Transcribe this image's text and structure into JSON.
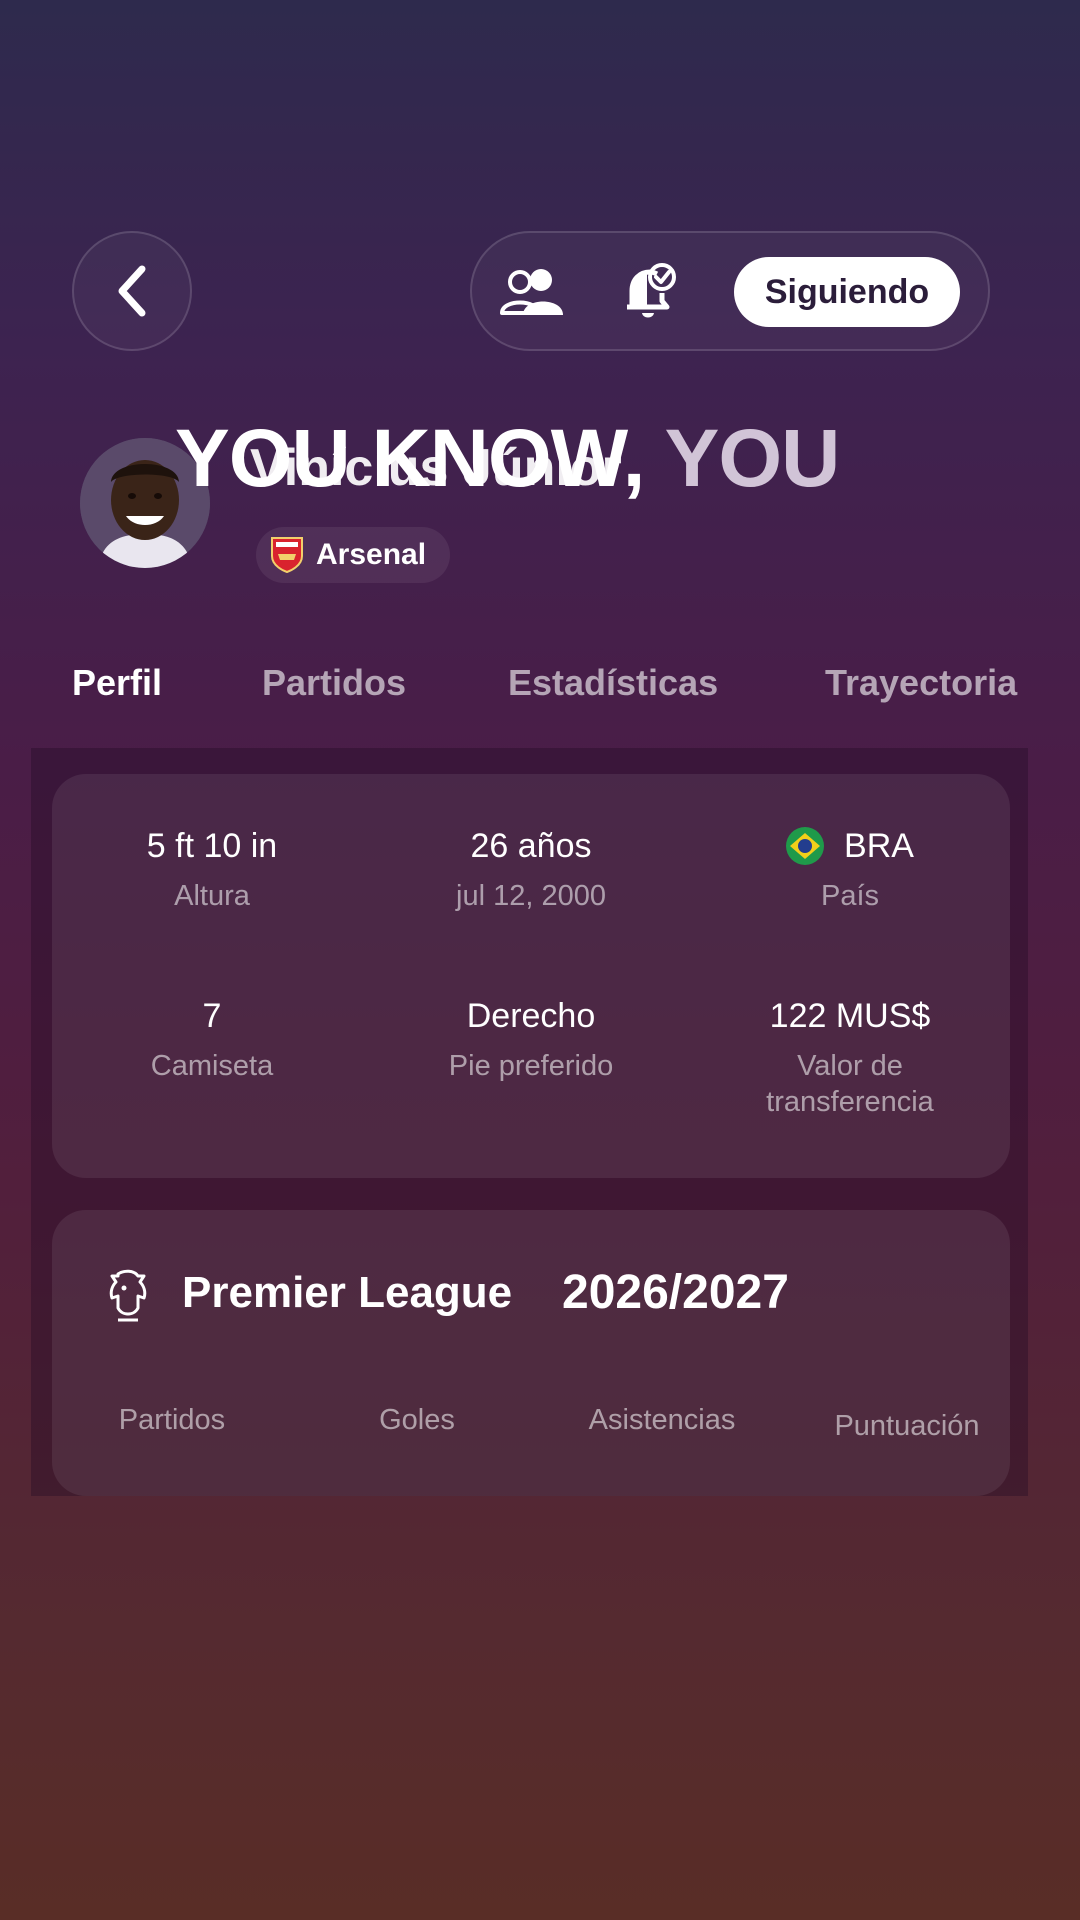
{
  "header": {
    "back_icon": "chevron-left-icon",
    "compare_icon": "users-icon",
    "notify_icon": "bell-check-icon",
    "follow_label": "Siguiendo"
  },
  "player": {
    "name": "Vinícius Júnior",
    "overlay_text_a": "YOU KNOW,",
    "overlay_text_b": "YOU",
    "team": "Arsenal"
  },
  "tabs": [
    {
      "label": "Perfil",
      "active": true
    },
    {
      "label": "Partidos",
      "active": false
    },
    {
      "label": "Estadísticas",
      "active": false
    },
    {
      "label": "Trayectoria",
      "active": false
    }
  ],
  "profile": {
    "height": {
      "value": "5 ft 10 in",
      "label": "Altura"
    },
    "age": {
      "value": "26 años",
      "label": "jul 12, 2000"
    },
    "country": {
      "value": "BRA",
      "label": "País"
    },
    "shirt": {
      "value": "7",
      "label": "Camiseta"
    },
    "foot": {
      "value": "Derecho",
      "label": "Pie preferido"
    },
    "market_value": {
      "value": "122 MUS$",
      "label_line1": "Valor de",
      "label_line2": "transferencia"
    }
  },
  "league": {
    "name": "Premier League",
    "season": "2026/2027",
    "columns": [
      "Partidos",
      "Goles",
      "Asistencias",
      "Puntuación"
    ]
  },
  "colors": {
    "accent_white": "#ffffff",
    "follow_text": "#2b1d3a",
    "brazil_green": "#1f9a4a",
    "brazil_yellow": "#f2cf1a",
    "arsenal_red": "#d9232e"
  }
}
